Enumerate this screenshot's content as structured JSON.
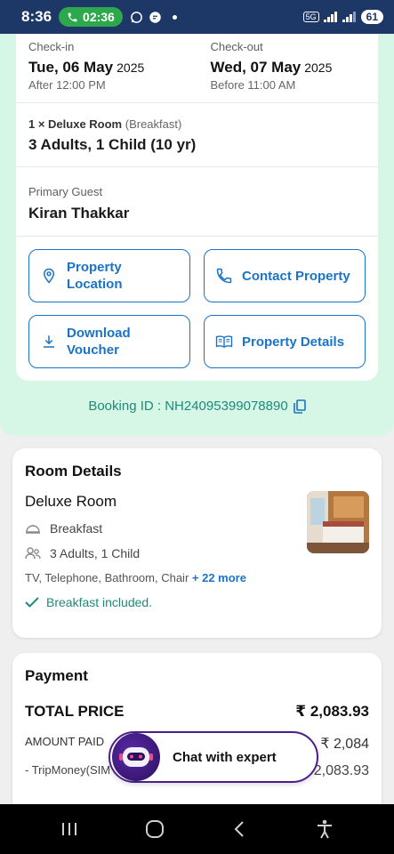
{
  "status_bar": {
    "time": "8:36",
    "call_timer": "02:36",
    "battery": "61",
    "network": "5G"
  },
  "stay": {
    "checkin_label": "Check-in",
    "checkin_date": "Tue, 06 May",
    "checkin_year": "2025",
    "checkin_time": "After  12:00 PM",
    "checkout_label": "Check-out",
    "checkout_date": "Wed, 07 May",
    "checkout_year": "2025",
    "checkout_time": "Before  11:00 AM",
    "room_line_bold": "1 × Deluxe Room",
    "room_line_plan": "(Breakfast)",
    "guests": "3 Adults, 1 Child (10 yr)",
    "primary_guest_label": "Primary Guest",
    "primary_guest_name": "Kiran  Thakkar"
  },
  "actions": {
    "location": "Property Location",
    "contact": "Contact Property",
    "voucher": "Download Voucher",
    "details": "Property Details"
  },
  "booking_id": "Booking ID : NH24095399078890",
  "room_details": {
    "title": "Room Details",
    "room_name": "Deluxe Room",
    "meal": "Breakfast",
    "occupancy": "3 Adults, 1 Child",
    "amenities": "TV, Telephone, Bathroom, Chair",
    "more": "+ 22 more",
    "included": "Breakfast included."
  },
  "payment": {
    "title": "Payment",
    "total_label": "TOTAL PRICE",
    "total_value": "₹ 2,083.93",
    "paid_label": "AMOUNT PAID",
    "paid_value": "₹ 2,084",
    "sub_label": "- TripMoney(SIM",
    "sub_value": "2,083.93"
  },
  "chat": {
    "label": "Chat with expert"
  },
  "colors": {
    "accent": "#1a73c7",
    "teal": "#1f8a78",
    "header": "#1d3766",
    "mint": "#d6f6e6"
  }
}
